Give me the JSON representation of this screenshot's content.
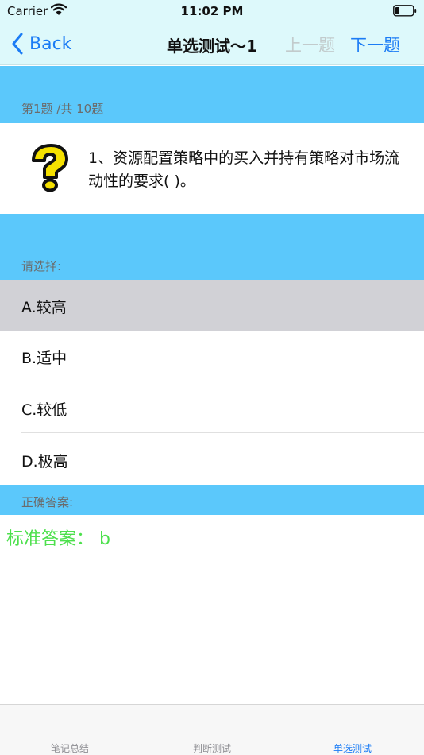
{
  "status_bar": {
    "carrier": "Carrier",
    "time": "11:02 PM"
  },
  "nav": {
    "back_label": "Back",
    "title": "单选测试～1",
    "prev_label": "上一题",
    "next_label": "下一题"
  },
  "question": {
    "counter": "第1题 /共 10题",
    "text": "1、资源配置策略中的买入并持有策略对市场流动性的要求( )。"
  },
  "options_section": {
    "label": "请选择:",
    "options": [
      {
        "text": "A.较高",
        "selected": true
      },
      {
        "text": "B.适中",
        "selected": false
      },
      {
        "text": "C.较低",
        "selected": false
      },
      {
        "text": "D.极高",
        "selected": false
      }
    ]
  },
  "answer_section": {
    "label": "正确答案:",
    "answer_text": "标准答案： b"
  },
  "tab_bar": {
    "tabs": [
      {
        "label": "笔记总结",
        "active": false
      },
      {
        "label": "判断测试",
        "active": false
      },
      {
        "label": "单选测试",
        "active": true
      }
    ]
  },
  "colors": {
    "accent": "#1b7cf5",
    "band": "#5bc8fb",
    "nav_background": "#ddf9fb",
    "answer_green": "#4de04d",
    "selected_row": "#d1d1d6"
  }
}
